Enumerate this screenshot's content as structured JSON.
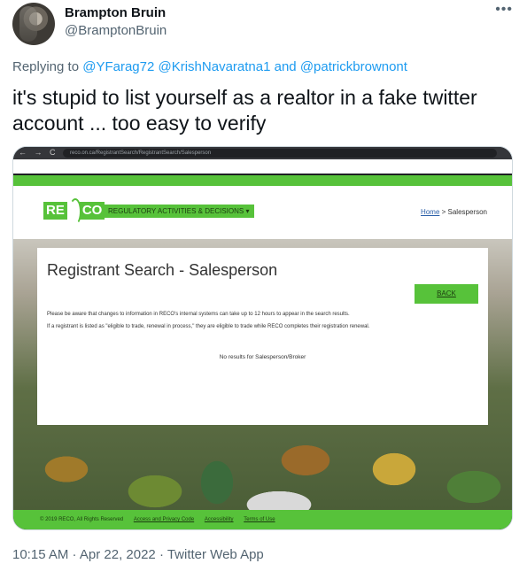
{
  "tweet": {
    "display_name": "Brampton Bruin",
    "handle": "@BramptonBruin",
    "more_icon": "more-dots-icon",
    "replying_prefix": "Replying to",
    "replying_to": [
      "@YFarag72",
      "@KrishNavaratna1",
      "@patrickbrownont"
    ],
    "replying_and": "and",
    "text": "it's stupid to list yourself as a realtor in a fake twitter account ... too easy to verify",
    "timestamp": "10:15 AM · Apr 22, 2022 · Twitter Web App"
  },
  "screenshot": {
    "browser": {
      "nav_icons": "← → C",
      "url": "reco.on.ca/RegistrantSearch/RegistrantSearch/Salesperson"
    },
    "site": {
      "logo_left": "RE",
      "logo_right": "CO",
      "menu_label": "REGULATORY ACTIVITIES & DECISIONS ▾",
      "breadcrumb_home": "Home",
      "breadcrumb_current": "> Salesperson"
    },
    "card": {
      "title": "Registrant Search - Salesperson",
      "back_label": "BACK",
      "notice_1": "Please be aware that changes to information in RECO's internal systems can take up to 12 hours to appear in the search results.",
      "notice_2": "If a registrant is listed as \"eligible to trade, renewal in process,\" they are eligible to trade while RECO completes their registration renewal.",
      "no_results": "No results for Salesperson/Broker"
    },
    "footer": {
      "copyright": "© 2019 RECO, All Rights Reserved",
      "links": [
        "Access and Privacy Code",
        "Accessibility",
        "Terms of Use"
      ]
    }
  },
  "colors": {
    "link_blue": "#1d9bf0",
    "muted_gray": "#536471",
    "reco_green": "#57c23a"
  }
}
